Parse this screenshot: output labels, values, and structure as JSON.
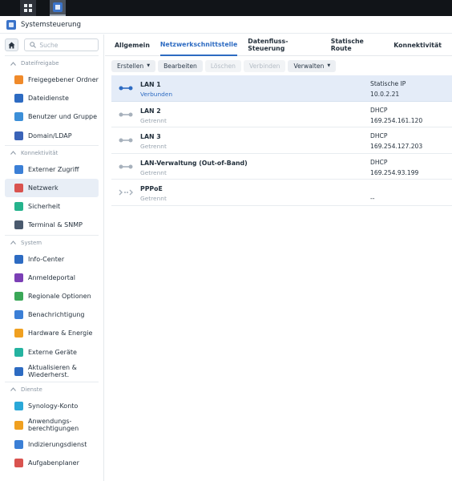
{
  "app": {
    "title": "Systemsteuerung"
  },
  "search": {
    "placeholder": "Suche"
  },
  "sidebar": {
    "sections": [
      {
        "label": "Dateifreigabe",
        "items": [
          {
            "label": "Freigegebener Ordner",
            "icon": "folder-icon",
            "color": "#f08a2a"
          },
          {
            "label": "Dateidienste",
            "icon": "file-services-icon",
            "color": "#2d6bc2"
          },
          {
            "label": "Benutzer und Gruppe",
            "icon": "users-icon",
            "color": "#3c8fd8"
          },
          {
            "label": "Domain/LDAP",
            "icon": "domain-icon",
            "color": "#3a63b8"
          }
        ]
      },
      {
        "label": "Konnektivität",
        "items": [
          {
            "label": "Externer Zugriff",
            "icon": "external-access-icon",
            "color": "#3b7fd6"
          },
          {
            "label": "Netzwerk",
            "icon": "network-icon",
            "color": "#d9534f",
            "active": true
          },
          {
            "label": "Sicherheit",
            "icon": "shield-icon",
            "color": "#25b38c"
          },
          {
            "label": "Terminal & SNMP",
            "icon": "terminal-icon",
            "color": "#4a5a6e"
          }
        ]
      },
      {
        "label": "System",
        "items": [
          {
            "label": "Info-Center",
            "icon": "info-icon",
            "color": "#2d6bc2"
          },
          {
            "label": "Anmeldeportal",
            "icon": "portal-icon",
            "color": "#7b3fb5"
          },
          {
            "label": "Regionale Optionen",
            "icon": "regional-icon",
            "color": "#3aa757"
          },
          {
            "label": "Benachrichtigung",
            "icon": "notification-icon",
            "color": "#3b7fd6"
          },
          {
            "label": "Hardware & Energie",
            "icon": "power-icon",
            "color": "#f0a020"
          },
          {
            "label": "Externe Geräte",
            "icon": "external-devices-icon",
            "color": "#25b3a0"
          },
          {
            "label": "Aktualisieren & Wiederherst.",
            "icon": "update-icon",
            "color": "#2d6bc2",
            "two_line": true
          }
        ]
      },
      {
        "label": "Dienste",
        "items": [
          {
            "label": "Synology-Konto",
            "icon": "account-icon",
            "color": "#2aa8d8"
          },
          {
            "label": "Anwendungs-berechtigungen",
            "icon": "lock-icon",
            "color": "#f0a020",
            "two_line": true
          },
          {
            "label": "Indizierungsdienst",
            "icon": "index-icon",
            "color": "#3b7fd6"
          },
          {
            "label": "Aufgabenplaner",
            "icon": "calendar-icon",
            "color": "#d9534f"
          }
        ]
      }
    ]
  },
  "tabs": [
    {
      "label": "Allgemein",
      "active": false
    },
    {
      "label": "Netzwerkschnittstelle",
      "active": true
    },
    {
      "label": "Datenfluss-Steuerung",
      "active": false
    },
    {
      "label": "Statische Route",
      "active": false
    },
    {
      "label": "Konnektivität",
      "active": false
    }
  ],
  "toolbar": {
    "create": "Erstellen",
    "edit": "Bearbeiten",
    "delete": "Löschen",
    "connect": "Verbinden",
    "manage": "Verwalten"
  },
  "interfaces": [
    {
      "name": "LAN 1",
      "status": "Verbunden",
      "connected": true,
      "type": "Statische IP",
      "ip": "10.0.2.21",
      "icon": "lan-icon"
    },
    {
      "name": "LAN 2",
      "status": "Getrennt",
      "connected": false,
      "type": "DHCP",
      "ip": "169.254.161.120",
      "icon": "lan-icon"
    },
    {
      "name": "LAN 3",
      "status": "Getrennt",
      "connected": false,
      "type": "DHCP",
      "ip": "169.254.127.203",
      "icon": "lan-icon"
    },
    {
      "name": "LAN-Verwaltung (Out-of-Band)",
      "status": "Getrennt",
      "connected": false,
      "type": "DHCP",
      "ip": "169.254.93.199",
      "icon": "lan-icon"
    },
    {
      "name": "PPPoE",
      "status": "Getrennt",
      "connected": false,
      "type": "",
      "ip": "--",
      "icon": "pppoe-icon"
    }
  ]
}
